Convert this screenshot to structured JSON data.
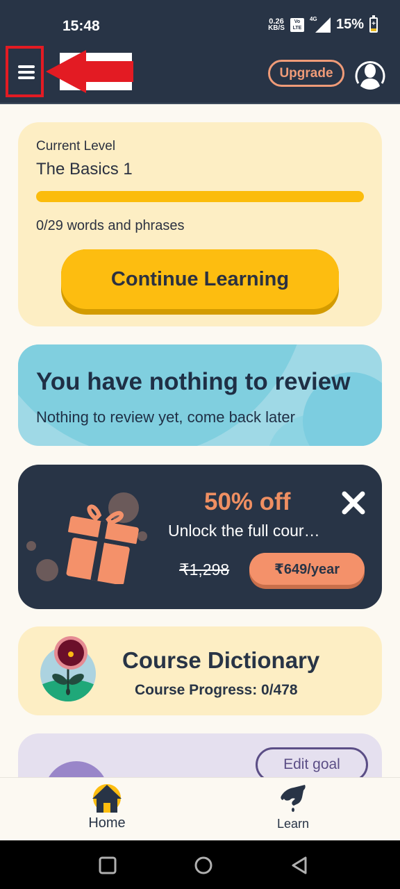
{
  "status_bar": {
    "time": "15:48",
    "net_speed_value": "0.26",
    "net_speed_unit": "KB/S",
    "volte_label_top": "Vo",
    "volte_label_bottom": "LTE",
    "network_label": "4G",
    "battery_percent": "15%"
  },
  "app_bar": {
    "upgrade_label": "Upgrade",
    "menu_icon": "hamburger-menu-icon",
    "profile_icon": "user-avatar-icon"
  },
  "level_card": {
    "label": "Current Level",
    "title": "The Basics 1",
    "progress_fraction": 0,
    "words_progress": "0/29 words and phrases",
    "continue_label": "Continue Learning"
  },
  "review_card": {
    "title": "You have nothing to review",
    "subtitle": "Nothing to review yet, come back later"
  },
  "promo_card": {
    "discount": "50% off",
    "description": "Unlock the full cour…",
    "old_price": "₹1,298",
    "price_button_label": "₹649/year",
    "close_icon": "close-icon",
    "gift_icon": "gift-icon"
  },
  "dictionary_card": {
    "title": "Course Dictionary",
    "subtitle": "Course Progress: 0/478",
    "icon": "flower-icon"
  },
  "goal_card": {
    "edit_goal_label": "Edit goal"
  },
  "bottom_nav": {
    "items": [
      {
        "label": "Home",
        "icon": "home-icon",
        "active": true
      },
      {
        "label": "Learn",
        "icon": "learn-hand-icon",
        "active": false
      }
    ]
  },
  "system_nav": {
    "buttons": [
      "recents-icon",
      "home-circle-icon",
      "back-icon"
    ]
  },
  "colors": {
    "app_bar_bg": "#283446",
    "accent_orange": "#ef9b78",
    "accent_yellow": "#fdbd10",
    "annotation_red": "#e31b23"
  }
}
